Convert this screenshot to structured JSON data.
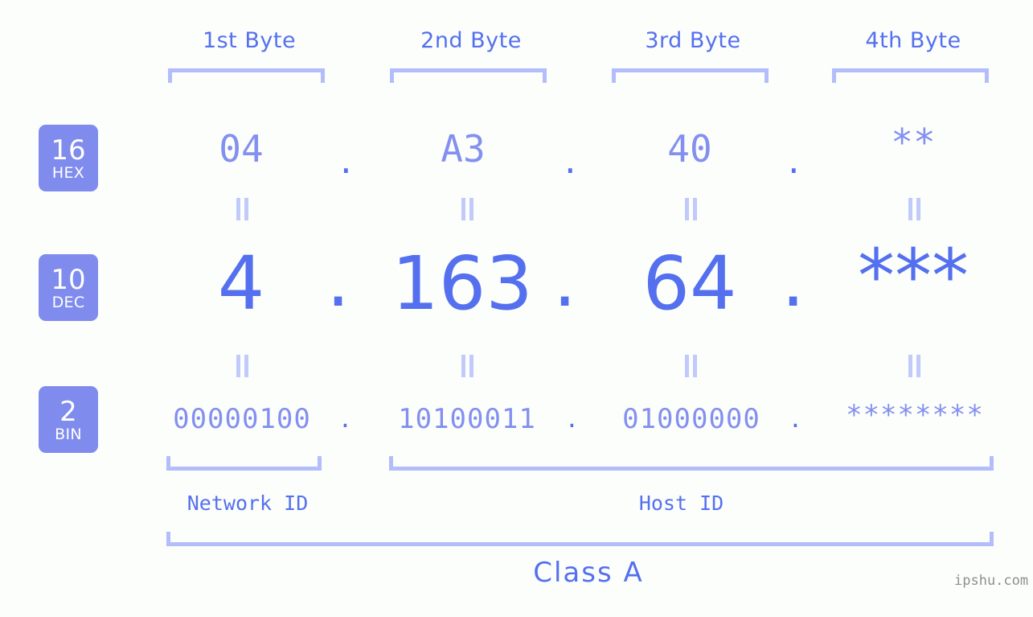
{
  "background_color": "#fcfefb",
  "accent_color": "#5570ef",
  "muted_accent_color": "#8390ef",
  "bracket_color": "#b4bdfb",
  "badge_bg_color": "#7f8cee",
  "byte_headers": [
    {
      "label": "1st Byte"
    },
    {
      "label": "2nd Byte"
    },
    {
      "label": "3rd Byte"
    },
    {
      "label": "4th Byte"
    }
  ],
  "rows": {
    "hex": {
      "badge_num": "16",
      "badge_sub": "HEX",
      "values": [
        "04",
        "A3",
        "40",
        "**"
      ],
      "separator": "."
    },
    "dec": {
      "badge_num": "10",
      "badge_sub": "DEC",
      "values": [
        "4",
        "163",
        "64",
        "***"
      ],
      "separator": "."
    },
    "bin": {
      "badge_num": "2",
      "badge_sub": "BIN",
      "values": [
        "00000100",
        "10100011",
        "01000000",
        "********"
      ],
      "separator": "."
    }
  },
  "equals_symbol": "=",
  "footer": {
    "network_id_label": "Network ID",
    "host_id_label": "Host ID",
    "class_label": "Class A",
    "watermark": "ipshu.com"
  }
}
